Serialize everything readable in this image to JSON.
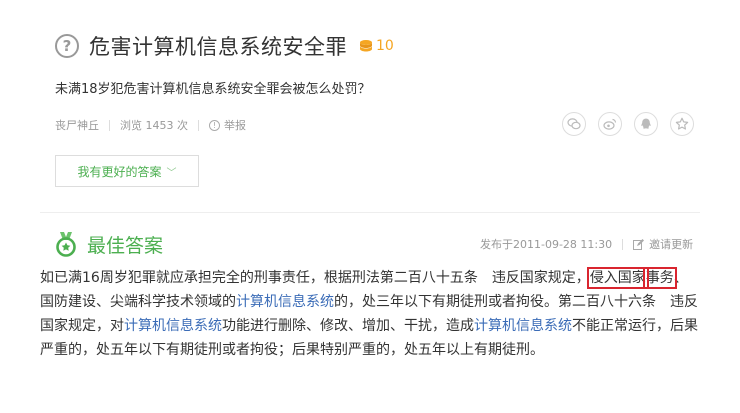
{
  "question": {
    "title": "危害计算机信息系统安全罪",
    "reward": "10",
    "description": "未满18岁犯危害计算机信息系统安全罪会被怎么处罚？",
    "asker": "丧尸神丘",
    "views": "浏览 1453 次",
    "report": "举报"
  },
  "better_answer_button": "我有更好的答案",
  "best_answer": {
    "label": "最佳答案",
    "published": "发布于2011-09-28 11:30",
    "invite": "邀请更新",
    "segments": [
      {
        "text": "如已满16周岁犯罪就应承担完全的刑事责任，根据刑法第二百八十五条　违反国家规定，"
      },
      {
        "text": "侵入国家",
        "style": "box"
      },
      {
        "text": "事务",
        "style": "box"
      },
      {
        "text": "、国防建设、尖端科学技术领域的"
      },
      {
        "text": "计算机信息系统",
        "style": "link"
      },
      {
        "text": "的，处三年以下有期徒刑或者拘役。第二百八十六条　违反国家规定，对"
      },
      {
        "text": "计算机信息系统",
        "style": "link"
      },
      {
        "text": "功能进行删除、修改、增加、干扰，造成"
      },
      {
        "text": "计算机信息系统",
        "style": "link"
      },
      {
        "text": "不能正常运行，后果严重的，处五年以下有期徒刑或者拘役；后果特别严重的，处五年以上有期徒刑。"
      }
    ]
  },
  "colors": {
    "accent": "#4caf50",
    "link": "#3b6cb7",
    "highlight_box": "#d9252f",
    "reward": "#f5a623"
  }
}
